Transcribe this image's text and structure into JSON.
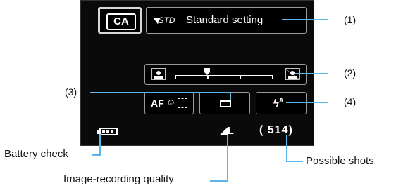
{
  "screen": {
    "mode": "CA",
    "style_icon": "STD",
    "style_label": "Standard setting",
    "af_label": "AF",
    "flash_symbol": "ϟ",
    "flash_sup": "A",
    "quality": "L",
    "shots": "514"
  },
  "callouts": {
    "n1": "(1)",
    "n2": "(2)",
    "n3": "(3)",
    "n4": "(4)",
    "battery": "Battery check",
    "quality": "Image-recording quality",
    "shots": "Possible shots"
  },
  "colors": {
    "callout_line": "#5ab7e8"
  }
}
